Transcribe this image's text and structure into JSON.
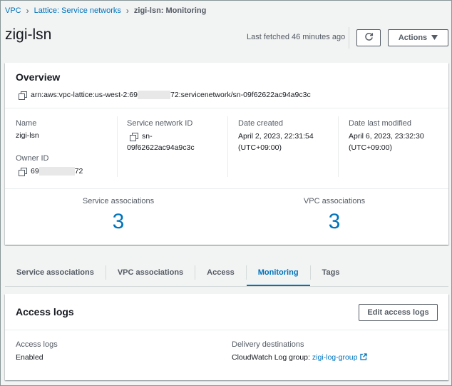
{
  "breadcrumb": {
    "items": [
      "VPC",
      "Lattice: Service networks"
    ],
    "current": "zigi-lsn: Monitoring"
  },
  "header": {
    "title": "zigi-lsn",
    "last_fetched": "Last fetched 46 minutes ago",
    "actions_label": "Actions"
  },
  "overview": {
    "title": "Overview",
    "arn_prefix": "arn:aws:vpc-lattice:us-west-2:69",
    "arn_suffix": "72:servicenetwork/sn-09f62622ac94a9c3c",
    "name_label": "Name",
    "name_value": "zigi-lsn",
    "owner_label": "Owner ID",
    "owner_prefix": "69",
    "owner_suffix": "72",
    "sn_id_label": "Service network ID",
    "sn_id_line1": "sn-",
    "sn_id_line2": "09f62622ac94a9c3c",
    "created_label": "Date created",
    "created_line1": "April 2, 2023, 22:31:54",
    "created_line2": "(UTC+09:00)",
    "modified_label": "Date last modified",
    "modified_line1": "April 6, 2023, 23:32:30",
    "modified_line2": "(UTC+09:00)",
    "service_assoc_label": "Service associations",
    "service_assoc_value": "3",
    "vpc_assoc_label": "VPC associations",
    "vpc_assoc_value": "3"
  },
  "tabs": [
    {
      "label": "Service associations"
    },
    {
      "label": "VPC associations"
    },
    {
      "label": "Access"
    },
    {
      "label": "Monitoring"
    },
    {
      "label": "Tags"
    }
  ],
  "access_logs": {
    "title": "Access logs",
    "edit_label": "Edit access logs",
    "status_label": "Access logs",
    "status_value": "Enabled",
    "dest_label": "Delivery destinations",
    "dest_prefix": "CloudWatch Log group:",
    "dest_link": "zigi-log-group"
  },
  "colors": {
    "link": "#0073bb",
    "text": "#16191f",
    "secondary": "#545b64",
    "background": "#f2f3f3"
  }
}
